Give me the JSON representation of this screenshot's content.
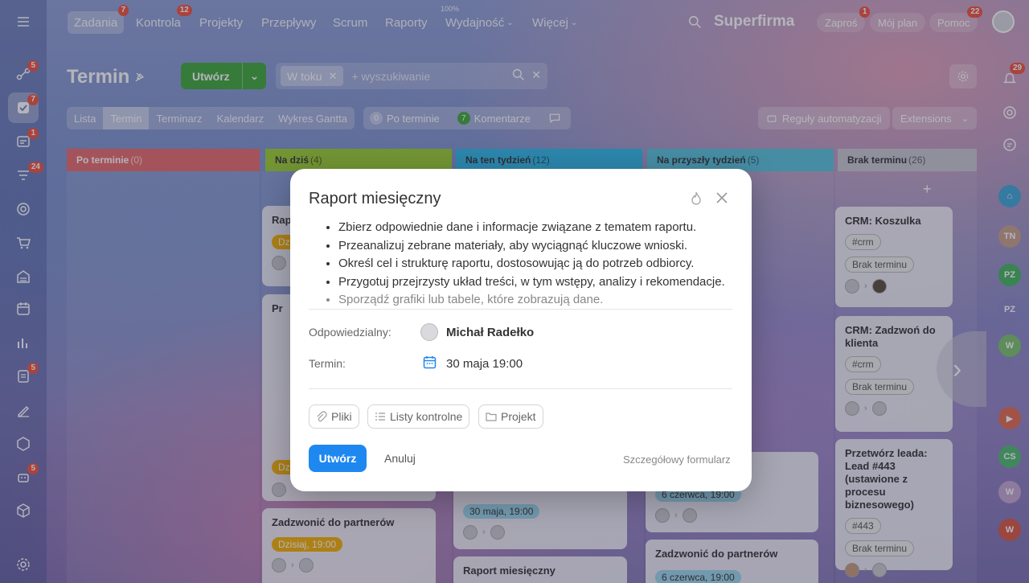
{
  "topnav": {
    "items": [
      {
        "label": "Zadania",
        "badge": "7"
      },
      {
        "label": "Kontrola",
        "badge": "12"
      },
      {
        "label": "Projekty"
      },
      {
        "label": "Przepływy"
      },
      {
        "label": "Scrum"
      },
      {
        "label": "Raporty"
      },
      {
        "label": "Wydajność",
        "super": "100%"
      },
      {
        "label": "Więcej"
      }
    ],
    "brand": "Superfirma",
    "invite": {
      "label": "Zaproś",
      "badge": "1"
    },
    "myplan": "Mój plan",
    "help": {
      "label": "Pomoc",
      "badge": "22"
    }
  },
  "left_rail_badges": {
    "b1": "5",
    "b2": "7",
    "b3": "1",
    "b4": "24",
    "b5": "5",
    "b6": "5"
  },
  "page": {
    "title": "Termin",
    "create_label": "Utwórz",
    "filter_chip": "W toku",
    "search_placeholder": "+ wyszukiwanie"
  },
  "view_tabs": [
    "Lista",
    "Termin",
    "Terminarz",
    "Kalendarz",
    "Wykres Gantta"
  ],
  "counters": {
    "overdue_count": "0",
    "overdue_label": "Po terminie",
    "comments_count": "7",
    "comments_label": "Komentarze"
  },
  "tools": {
    "automation": "Reguły automatyzacji",
    "extensions": "Extensions"
  },
  "columns": [
    {
      "name": "Po terminie",
      "count": "(0)",
      "color": "#e96a6a"
    },
    {
      "name": "Na dziś",
      "count": "(4)",
      "color": "#9cd030"
    },
    {
      "name": "Na ten tydzień",
      "count": "(12)",
      "color": "#2fb8e8"
    },
    {
      "name": "Na przyszły tydzień",
      "count": "(5)",
      "color": "#56c3dc"
    },
    {
      "name": "Brak terminu",
      "count": "(26)",
      "color": "#c8c8d0"
    }
  ],
  "cards": {
    "today_1_title": "Rap",
    "today_1_due": "Dzisiaj",
    "today_2_title": "Pr",
    "today_3_due": "Dz",
    "today_4_title": "Zadzwonić do partnerów",
    "today_4_due": "Dzisiaj, 19:00",
    "week_due": "30 maja, 19:00",
    "week_title": "Raport miesięczny",
    "nextweek_due": "6 czerwca, 19:00",
    "nextweek_title": "Zadzwonić do partnerów",
    "nextweek_due2": "6 czerwca, 19:00",
    "nodue_1_title": "CRM: Koszulka",
    "nodue_1_tag": "#crm",
    "nodue_1_due": "Brak terminu",
    "nodue_2_title": "CRM: Zadzwoń do klienta",
    "nodue_2_tag": "#crm",
    "nodue_2_due": "Brak terminu",
    "nodue_3_title": "Przetwórz leada: Lead #443 (ustawione z procesu biznesowego)",
    "nodue_3_tag": "#443",
    "nodue_3_due": "Brak terminu"
  },
  "right_rail": {
    "notif_badge": "29",
    "dots": [
      "TN",
      "PZ",
      "PZ",
      "W",
      "CS",
      "W",
      "W"
    ]
  },
  "modal": {
    "title": "Raport miesięczny",
    "description": [
      "Zbierz odpowiednie dane i informacje związane z tematem raportu.",
      "Przeanalizuj zebrane materiały, aby wyciągnąć kluczowe wnioski.",
      "Określ cel i strukturę raportu, dostosowując ją do potrzeb odbiorcy.",
      "Przygotuj przejrzysty układ treści, w tym wstępy, analizy i rekomendacje.",
      "Sporządź grafiki lub tabele, które zobrazują dane."
    ],
    "responsible_label": "Odpowiedzialny:",
    "responsible_name": "Michał Radełko",
    "deadline_label": "Termin:",
    "deadline_value": "30 maja 19:00",
    "attach": {
      "files": "Pliki",
      "checklists": "Listy kontrolne",
      "project": "Projekt"
    },
    "create_button": "Utwórz",
    "cancel_button": "Anuluj",
    "detail_link": "Szczegółowy formularz"
  }
}
